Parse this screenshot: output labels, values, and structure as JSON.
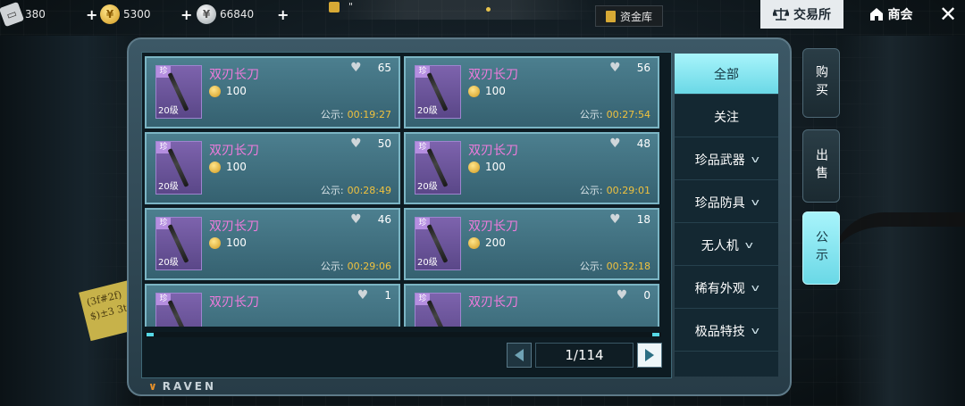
{
  "currencies": [
    {
      "name": "ticket",
      "value": "380"
    },
    {
      "name": "gold",
      "value": "5300"
    },
    {
      "name": "silver",
      "value": "66840"
    }
  ],
  "top": {
    "mid_text": "\"",
    "fund_label": "资金库",
    "tab_exchange": "交易所",
    "tab_shop": "商会"
  },
  "items": [
    {
      "name": "双刃长刀",
      "price": "100",
      "likes": "65",
      "badge": "珍",
      "level": "20级",
      "timer_label": "公示:",
      "timer": "00:19:27"
    },
    {
      "name": "双刃长刀",
      "price": "100",
      "likes": "56",
      "badge": "珍",
      "level": "20级",
      "timer_label": "公示:",
      "timer": "00:27:54"
    },
    {
      "name": "双刃长刀",
      "price": "100",
      "likes": "50",
      "badge": "珍",
      "level": "20级",
      "timer_label": "公示:",
      "timer": "00:28:49"
    },
    {
      "name": "双刃长刀",
      "price": "100",
      "likes": "48",
      "badge": "珍",
      "level": "20级",
      "timer_label": "公示:",
      "timer": "00:29:01"
    },
    {
      "name": "双刃长刀",
      "price": "100",
      "likes": "46",
      "badge": "珍",
      "level": "20级",
      "timer_label": "公示:",
      "timer": "00:29:06"
    },
    {
      "name": "双刃长刀",
      "price": "200",
      "likes": "18",
      "badge": "珍",
      "level": "20级",
      "timer_label": "公示:",
      "timer": "00:32:18"
    },
    {
      "name": "双刃长刀",
      "price": "",
      "likes": "1",
      "badge": "珍",
      "level": "",
      "timer_label": "",
      "timer": ""
    },
    {
      "name": "双刃长刀",
      "price": "",
      "likes": "0",
      "badge": "珍",
      "level": "",
      "timer_label": "",
      "timer": ""
    }
  ],
  "pager": {
    "text": "1/114"
  },
  "brand": "RAVEN",
  "categories": [
    {
      "label": "全部",
      "active": true,
      "dropdown": false
    },
    {
      "label": "关注",
      "active": false,
      "dropdown": false
    },
    {
      "label": "珍品武器",
      "active": false,
      "dropdown": true
    },
    {
      "label": "珍品防具",
      "active": false,
      "dropdown": true
    },
    {
      "label": "无人机",
      "active": false,
      "dropdown": true
    },
    {
      "label": "稀有外观",
      "active": false,
      "dropdown": true
    },
    {
      "label": "极品特技",
      "active": false,
      "dropdown": true
    }
  ],
  "side_tabs": [
    {
      "label": "购买",
      "active": false
    },
    {
      "label": "出售",
      "active": false
    },
    {
      "label": "公示",
      "active": true
    }
  ],
  "note_text": [
    "(3f#2f)",
    "$)±3 3t"
  ],
  "colors": {
    "accent": "#6ad8e6",
    "item_name": "#f07bdd",
    "timer": "#f0c23e",
    "card": "#356170"
  }
}
